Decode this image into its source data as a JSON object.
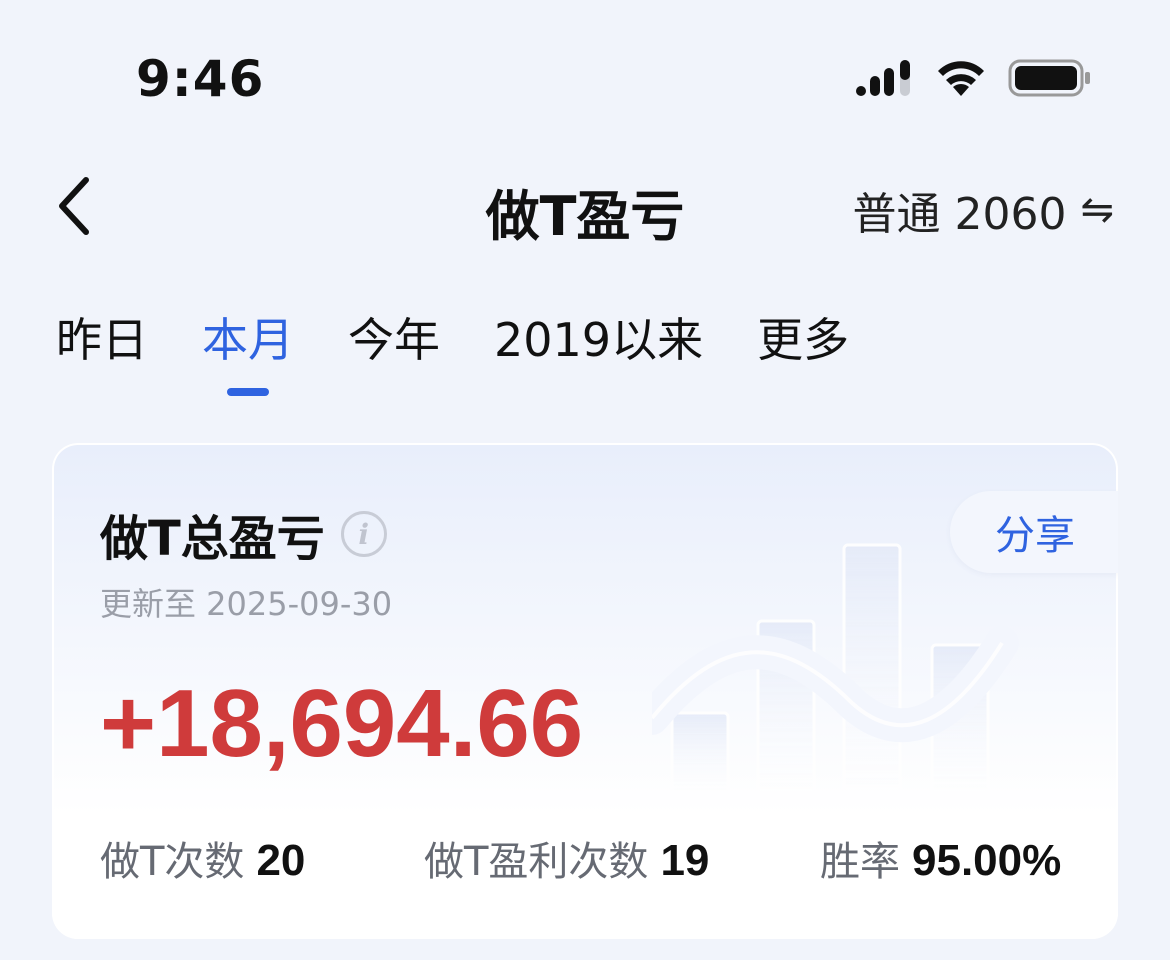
{
  "status_bar": {
    "time": "9:46"
  },
  "nav": {
    "title": "做T盈亏",
    "account_label": "普通 2060",
    "swap_symbol": "⇋"
  },
  "tabs": [
    {
      "label": "昨日",
      "active": false
    },
    {
      "label": "本月",
      "active": true
    },
    {
      "label": "今年",
      "active": false
    },
    {
      "label": "2019以来",
      "active": false
    },
    {
      "label": "更多",
      "active": false
    }
  ],
  "card": {
    "title": "做T总盈亏",
    "info_symbol": "i",
    "update_text": "更新至 2025-09-30",
    "share_label": "分享",
    "amount": "+18,694.66",
    "amount_color": "#CF3B3B",
    "stats": [
      {
        "label": "做T次数",
        "value": "20"
      },
      {
        "label": "做T盈利次数",
        "value": "19"
      },
      {
        "label": "胜率",
        "value": "95.00%"
      }
    ]
  },
  "colors": {
    "accent": "#2F63E0",
    "profit": "#CF3B3B",
    "background": "#F1F4FB"
  }
}
